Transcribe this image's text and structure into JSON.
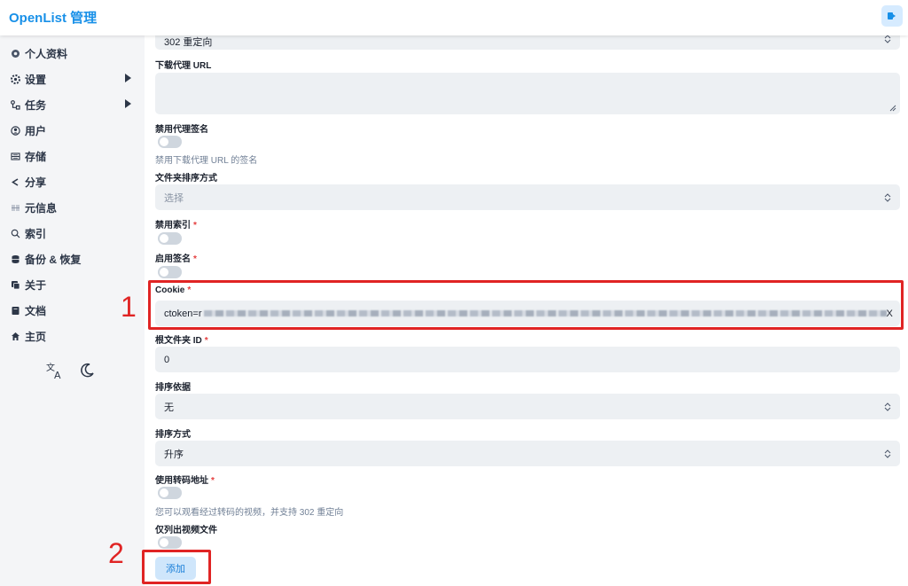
{
  "header": {
    "brand": "OpenList 管理"
  },
  "sidebar": {
    "items": [
      {
        "label": "个人资料",
        "icon": "gear-hex-icon"
      },
      {
        "label": "设置",
        "icon": "gear-icon",
        "expandable": true
      },
      {
        "label": "任务",
        "icon": "flow-icon",
        "expandable": true
      },
      {
        "label": "用户",
        "icon": "user-circle-icon"
      },
      {
        "label": "存储",
        "icon": "storage-icon"
      },
      {
        "label": "分享",
        "icon": "share-icon"
      },
      {
        "label": "元信息",
        "icon": "meta-icon"
      },
      {
        "label": "索引",
        "icon": "search-icon"
      },
      {
        "label": "备份 & 恢复",
        "icon": "database-icon"
      },
      {
        "label": "关于",
        "icon": "copy-icon"
      },
      {
        "label": "文档",
        "icon": "book-icon"
      },
      {
        "label": "主页",
        "icon": "home-icon"
      }
    ]
  },
  "form": {
    "top_select_value": "302 重定向",
    "download_proxy_url_label": "下载代理 URL",
    "download_proxy_url_value": "",
    "disable_proxy_sign_label": "禁用代理签名",
    "disable_proxy_sign_hint": "禁用下载代理 URL 的签名",
    "folder_sort_label": "文件夹排序方式",
    "folder_sort_placeholder": "选择",
    "disable_index_label": "禁用索引",
    "enable_sign_label": "启用签名",
    "cookie_label": "Cookie",
    "cookie_value_prefix": "ctoken=r",
    "cookie_value_suffix": "X",
    "root_folder_label": "根文件夹 ID",
    "root_folder_value": "0",
    "order_by_label": "排序依据",
    "order_by_value": "无",
    "order_direction_label": "排序方式",
    "order_direction_value": "升序",
    "use_transcode_label": "使用转码地址",
    "use_transcode_hint": "您可以观看经过转码的视频，并支持 302 重定向",
    "only_video_label": "仅列出视频文件",
    "required_mark": "*",
    "add_button": "添加"
  },
  "annotations": {
    "one": "1",
    "two": "2"
  },
  "colors": {
    "brand": "#1890e8",
    "annotation": "#e02424",
    "field_bg": "#edf0f3"
  }
}
